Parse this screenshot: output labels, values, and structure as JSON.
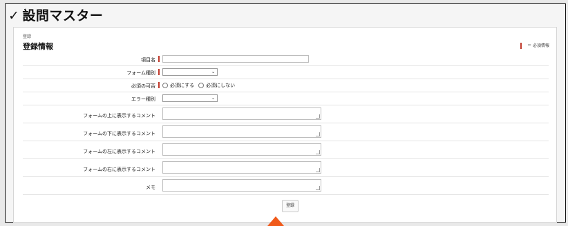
{
  "page": {
    "title": "設問マスター",
    "check": "✓"
  },
  "breadcrumb": "登録",
  "section": {
    "title": "登録情報"
  },
  "legend": {
    "text": "＝ 必須情報"
  },
  "form": {
    "item_name_label": "項目名",
    "form_type_label": "フォーム種別",
    "required_label": "必須の可否",
    "required_options": [
      "必須にする",
      "必須にしない"
    ],
    "error_type_label": "エラー種別",
    "comment_top_label": "フォームの上に表示するコメント",
    "comment_bottom_label": "フォームの下に表示するコメント",
    "comment_left_label": "フォームの左に表示するコメント",
    "comment_right_label": "フォームの右に表示するコメント",
    "memo_label": "メモ"
  },
  "submit_label": "登録",
  "colors": {
    "required_marker": "#c0392b",
    "pointer": "#f05a1a"
  }
}
